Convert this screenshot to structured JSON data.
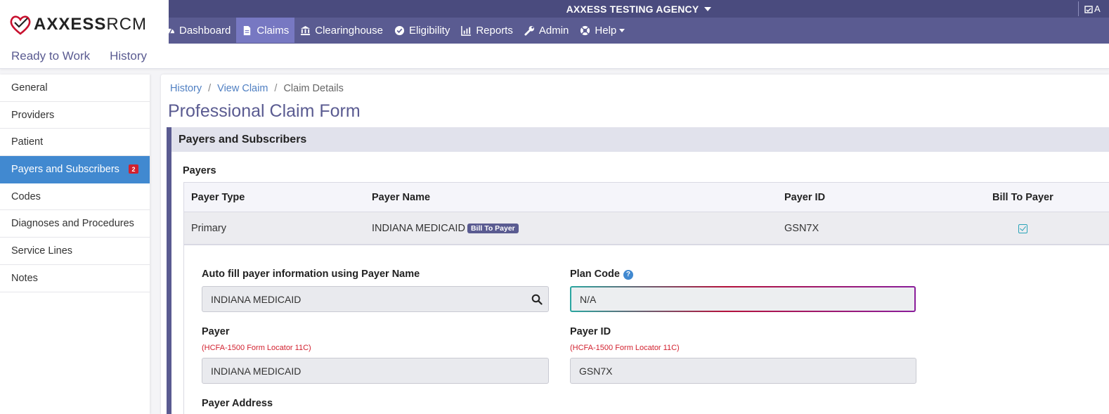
{
  "header": {
    "logo_text": "AXXESS",
    "logo_suffix": "RCM",
    "agency_name": "AXXESS TESTING AGENCY",
    "right_stub_text": "A"
  },
  "nav": {
    "items": [
      {
        "label": "Dashboard",
        "icon": "dashboard-icon"
      },
      {
        "label": "Claims",
        "icon": "document-icon"
      },
      {
        "label": "Clearinghouse",
        "icon": "bank-icon"
      },
      {
        "label": "Eligibility",
        "icon": "check-circle-icon"
      },
      {
        "label": "Reports",
        "icon": "bar-chart-icon"
      },
      {
        "label": "Admin",
        "icon": "wrench-icon"
      },
      {
        "label": "Help",
        "icon": "lifebuoy-icon"
      }
    ],
    "active": "Claims"
  },
  "subnav": {
    "items": [
      "Ready to Work",
      "History"
    ]
  },
  "sidebar": {
    "items": [
      {
        "label": "General"
      },
      {
        "label": "Providers"
      },
      {
        "label": "Patient"
      },
      {
        "label": "Payers and Subscribers",
        "badge": "2"
      },
      {
        "label": "Codes"
      },
      {
        "label": "Diagnoses and Procedures"
      },
      {
        "label": "Service Lines"
      },
      {
        "label": "Notes"
      }
    ],
    "active": "Payers and Subscribers"
  },
  "breadcrumb": {
    "items": [
      "History",
      "View Claim",
      "Claim Details"
    ],
    "sep": "/"
  },
  "page_title": "Professional Claim Form",
  "section": {
    "title": "Payers and Subscribers",
    "payers_label": "Payers",
    "table": {
      "headers": [
        "Payer Type",
        "Payer Name",
        "Payer ID",
        "Bill To Payer"
      ],
      "rows": [
        {
          "type": "Primary",
          "name": "INDIANA MEDICAID",
          "pill": "Bill To Payer",
          "id": "GSN7X",
          "bill_to_payer": true
        }
      ]
    },
    "form": {
      "autofill_label": "Auto fill payer information using Payer Name",
      "autofill_value": "INDIANA MEDICAID",
      "plan_code_label": "Plan Code",
      "plan_code_help": "?",
      "plan_code_value": "N/A",
      "payer_label": "Payer",
      "payer_note": "(HCFA-1500 Form Locator 11C)",
      "payer_value": "INDIANA MEDICAID",
      "payer_id_label": "Payer ID",
      "payer_id_note": "(HCFA-1500 Form Locator 11C)",
      "payer_id_value": "GSN7X",
      "payer_address_label": "Payer Address"
    }
  },
  "colors": {
    "brand": "#5a5b91",
    "nav_active": "#7778c2",
    "sidebar_active": "#4189d0",
    "badge": "#d2212f",
    "link": "#4f7fc2"
  }
}
